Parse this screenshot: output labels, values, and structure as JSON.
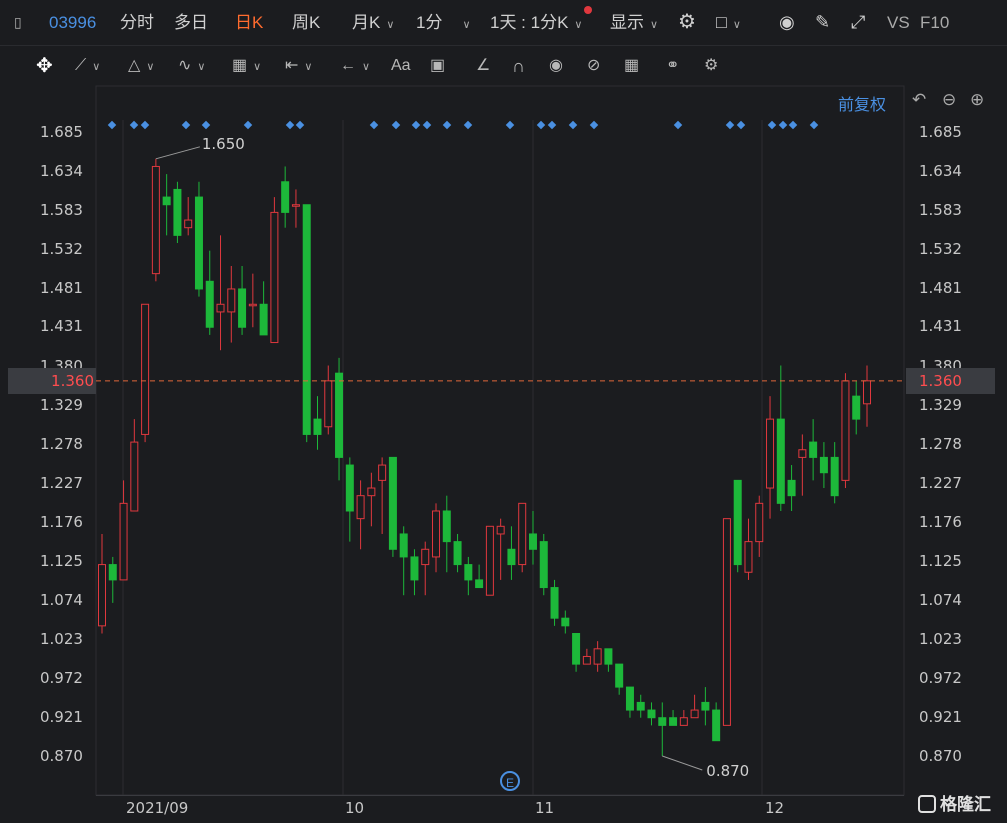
{
  "header": {
    "code": "03996",
    "tabs": [
      "分时",
      "多日",
      "日K",
      "周K",
      "月K",
      "1分"
    ],
    "active_tab": "日K",
    "range_selector": "1天 : 1分K",
    "display_label": "显示",
    "vs_label": "VS",
    "f10_label": "F10"
  },
  "toolbar": {
    "text_tool": "Aa"
  },
  "chart": {
    "adjust_label": "前复权",
    "current_price": "1.360",
    "high_label": "1.650",
    "low_label": "0.870",
    "y_ticks": [
      "1.685",
      "1.634",
      "1.583",
      "1.532",
      "1.481",
      "1.431",
      "1.380",
      "1.329",
      "1.278",
      "1.227",
      "1.176",
      "1.125",
      "1.074",
      "1.023",
      "0.972",
      "0.921",
      "0.870"
    ],
    "x_labels": [
      "2021/09",
      "10",
      "11",
      "12"
    ],
    "event_badge": "E",
    "colors": {
      "up": "#e0383e",
      "down": "#1db83a",
      "dash": "#e0653a",
      "marker": "#4a90e2"
    }
  },
  "logo_text": "格隆汇",
  "chart_data": {
    "type": "candlestick",
    "ylim": [
      0.87,
      1.685
    ],
    "candles": [
      [
        1.04,
        1.12,
        1.16,
        1.03
      ],
      [
        1.12,
        1.1,
        1.13,
        1.07
      ],
      [
        1.1,
        1.2,
        1.23,
        1.1
      ],
      [
        1.19,
        1.28,
        1.31,
        1.19
      ],
      [
        1.29,
        1.46,
        1.46,
        1.28
      ],
      [
        1.5,
        1.64,
        1.65,
        1.49
      ],
      [
        1.6,
        1.59,
        1.63,
        1.55
      ],
      [
        1.61,
        1.55,
        1.62,
        1.54
      ],
      [
        1.56,
        1.57,
        1.6,
        1.55
      ],
      [
        1.6,
        1.48,
        1.62,
        1.47
      ],
      [
        1.49,
        1.43,
        1.53,
        1.42
      ],
      [
        1.45,
        1.46,
        1.55,
        1.4
      ],
      [
        1.45,
        1.48,
        1.51,
        1.41
      ],
      [
        1.48,
        1.43,
        1.51,
        1.42
      ],
      [
        1.46,
        1.46,
        1.5,
        1.43
      ],
      [
        1.46,
        1.42,
        1.49,
        1.42
      ],
      [
        1.41,
        1.58,
        1.6,
        1.41
      ],
      [
        1.62,
        1.58,
        1.64,
        1.56
      ],
      [
        1.59,
        1.59,
        1.61,
        1.56
      ],
      [
        1.59,
        1.29,
        1.59,
        1.28
      ],
      [
        1.31,
        1.29,
        1.34,
        1.27
      ],
      [
        1.3,
        1.36,
        1.38,
        1.29
      ],
      [
        1.37,
        1.26,
        1.39,
        1.23
      ],
      [
        1.25,
        1.19,
        1.26,
        1.15
      ],
      [
        1.18,
        1.21,
        1.23,
        1.14
      ],
      [
        1.21,
        1.22,
        1.24,
        1.17
      ],
      [
        1.23,
        1.25,
        1.26,
        1.16
      ],
      [
        1.26,
        1.14,
        1.26,
        1.13
      ],
      [
        1.16,
        1.13,
        1.17,
        1.08
      ],
      [
        1.13,
        1.1,
        1.14,
        1.08
      ],
      [
        1.12,
        1.14,
        1.15,
        1.08
      ],
      [
        1.13,
        1.19,
        1.2,
        1.11
      ],
      [
        1.19,
        1.15,
        1.21,
        1.11
      ],
      [
        1.15,
        1.12,
        1.16,
        1.11
      ],
      [
        1.12,
        1.1,
        1.13,
        1.08
      ],
      [
        1.1,
        1.09,
        1.12,
        1.09
      ],
      [
        1.08,
        1.17,
        1.17,
        1.08
      ],
      [
        1.16,
        1.17,
        1.18,
        1.1
      ],
      [
        1.14,
        1.12,
        1.17,
        1.1
      ],
      [
        1.12,
        1.2,
        1.2,
        1.11
      ],
      [
        1.16,
        1.14,
        1.19,
        1.12
      ],
      [
        1.15,
        1.09,
        1.16,
        1.08
      ],
      [
        1.09,
        1.05,
        1.1,
        1.04
      ],
      [
        1.05,
        1.04,
        1.06,
        1.03
      ],
      [
        1.03,
        0.99,
        1.03,
        0.98
      ],
      [
        0.99,
        1.0,
        1.01,
        0.99
      ],
      [
        0.99,
        1.01,
        1.02,
        0.98
      ],
      [
        1.01,
        0.99,
        1.01,
        0.98
      ],
      [
        0.99,
        0.96,
        0.99,
        0.95
      ],
      [
        0.96,
        0.93,
        0.96,
        0.92
      ],
      [
        0.94,
        0.93,
        0.95,
        0.92
      ],
      [
        0.93,
        0.92,
        0.94,
        0.91
      ],
      [
        0.92,
        0.91,
        0.94,
        0.87
      ],
      [
        0.92,
        0.91,
        0.93,
        0.91
      ],
      [
        0.91,
        0.92,
        0.93,
        0.91
      ],
      [
        0.92,
        0.93,
        0.95,
        0.92
      ],
      [
        0.94,
        0.93,
        0.96,
        0.91
      ],
      [
        0.93,
        0.89,
        0.94,
        0.89
      ],
      [
        0.91,
        1.18,
        1.18,
        0.91
      ],
      [
        1.23,
        1.12,
        1.23,
        1.11
      ],
      [
        1.11,
        1.15,
        1.18,
        1.1
      ],
      [
        1.15,
        1.2,
        1.21,
        1.13
      ],
      [
        1.22,
        1.31,
        1.34,
        1.18
      ],
      [
        1.31,
        1.2,
        1.38,
        1.19
      ],
      [
        1.23,
        1.21,
        1.25,
        1.19
      ],
      [
        1.26,
        1.27,
        1.29,
        1.21
      ],
      [
        1.28,
        1.26,
        1.31,
        1.23
      ],
      [
        1.26,
        1.24,
        1.28,
        1.22
      ],
      [
        1.26,
        1.21,
        1.28,
        1.2
      ],
      [
        1.23,
        1.36,
        1.37,
        1.22
      ],
      [
        1.34,
        1.31,
        1.36,
        1.29
      ],
      [
        1.33,
        1.36,
        1.38,
        1.3
      ]
    ]
  }
}
